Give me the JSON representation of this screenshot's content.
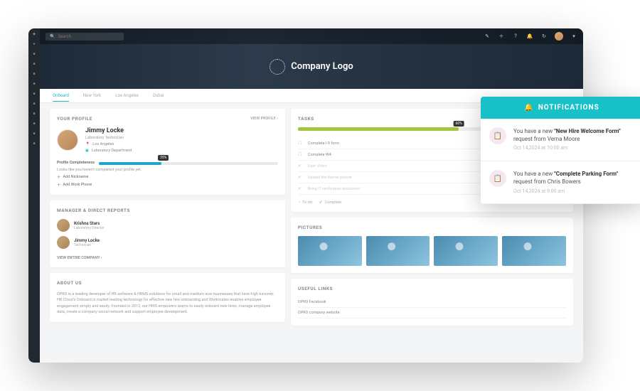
{
  "brand": {
    "label": "Company Logo"
  },
  "search": {
    "placeholder": "Search"
  },
  "tabs": [
    "Onboard",
    "New York",
    "Los Angeles",
    "Dubai"
  ],
  "profile": {
    "header": "YOUR PROFILE",
    "view_link": "VIEW PROFILE  ›",
    "name": "Jimmy Locke",
    "role": "Laboratory Technician",
    "location": "Los Angeles",
    "department": "Laboratory Department",
    "completeness_label": "Profile Completeness",
    "completeness_pct": "35%",
    "helper": "Looks like you haven't completed your profile yet.",
    "action_nickname": "Add Nickname",
    "action_phone": "Add Work Phone"
  },
  "manager": {
    "header": "MANAGER & DIRECT REPORTS",
    "people": [
      {
        "name": "Krishna Stars",
        "role": "Laboratory Director"
      },
      {
        "name": "Jimmy Locke",
        "role": "Technician"
      }
    ],
    "view_company": "VIEW ENTIRE COMPANY  ›"
  },
  "about": {
    "header": "ABOUT US",
    "text": "OPRO is a leading developer of HR software & HRMS solutions for small and medium size businesses that have high turnover. HR Cloud's Onboard is market leading technology for effective new hire onboarding and Workmates enables employee engagement simply and easily. Founded in 2012, our HRIS empowers teams to easily onboard new hires, manage employee data, create a company social network and support employee development."
  },
  "tasks": {
    "header": "TASKS",
    "pct": "60%",
    "items": [
      {
        "label": "Complete I-9 form",
        "done": false
      },
      {
        "label": "Complete W4",
        "done": false
      },
      {
        "label": "User Video",
        "done": true
      },
      {
        "label": "Upload the theme picture",
        "done": true
      },
      {
        "label": "Bring IT verification document",
        "done": true
      }
    ],
    "status_todo": "To do",
    "status_complete": "Complete"
  },
  "pictures": {
    "header": "PICTURES"
  },
  "links": {
    "header": "USEFUL LINKS",
    "items": [
      "OPRO Facebook",
      "OPRO company website"
    ]
  },
  "notifications": {
    "header": "NOTIFICATIONS",
    "items": [
      {
        "pre": "You have a new ",
        "bold": "\"New Hire Welcome Form\"",
        "post": " request from Verna Moore",
        "time": "Oct 14,2024 at 10:00 am"
      },
      {
        "pre": "You have a new ",
        "bold": "\"Complete Parking Form\"",
        "post": " request from Chris Bowers",
        "time": "Oct 14,2024 at 9:00 am"
      }
    ]
  }
}
